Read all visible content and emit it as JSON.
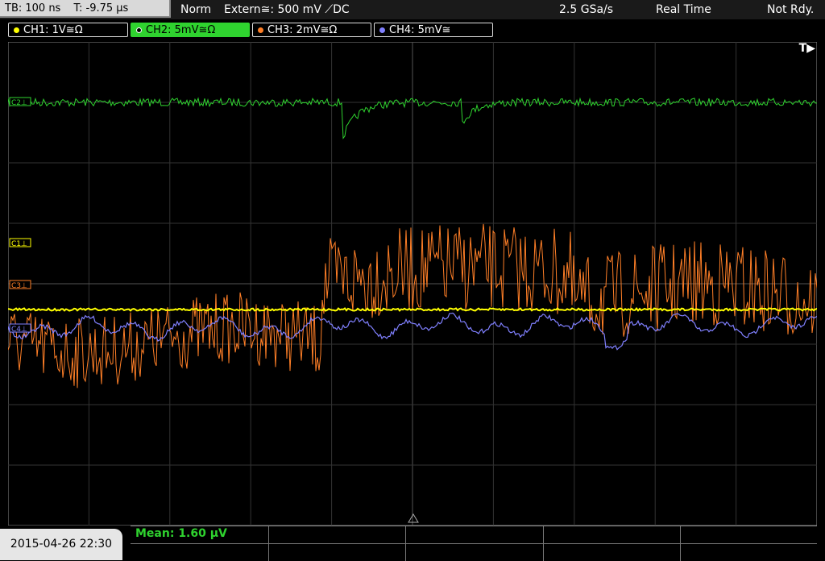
{
  "topbar": {
    "timebase": "TB: 100 ns",
    "trigger_offset": "T: -9.75 µs",
    "mode": "Norm",
    "trigger_source": "Extern≅: 500 mV ⟋DC",
    "sample_rate": "2.5 GSa/s",
    "acq": "Real Time",
    "status": "Not Rdy."
  },
  "channels": [
    {
      "label": "CH1: 1V≅Ω",
      "color": "#ffff00"
    },
    {
      "label": "CH2: 5mV≅Ω",
      "color": "#2fd32f"
    },
    {
      "label": "CH3: 2mV≅Ω",
      "color": "#ff7f27"
    },
    {
      "label": "CH4: 5mV≅",
      "color": "#8080ff"
    }
  ],
  "markers": {
    "c2": "C2⊥",
    "c1": "C1⊥",
    "c3": "C3⊥",
    "c4": "C4⊥",
    "trigger": "T▶"
  },
  "measurement": {
    "mean": "Mean: 1.60 µV"
  },
  "datetime": "2015-04-26 22:30"
}
